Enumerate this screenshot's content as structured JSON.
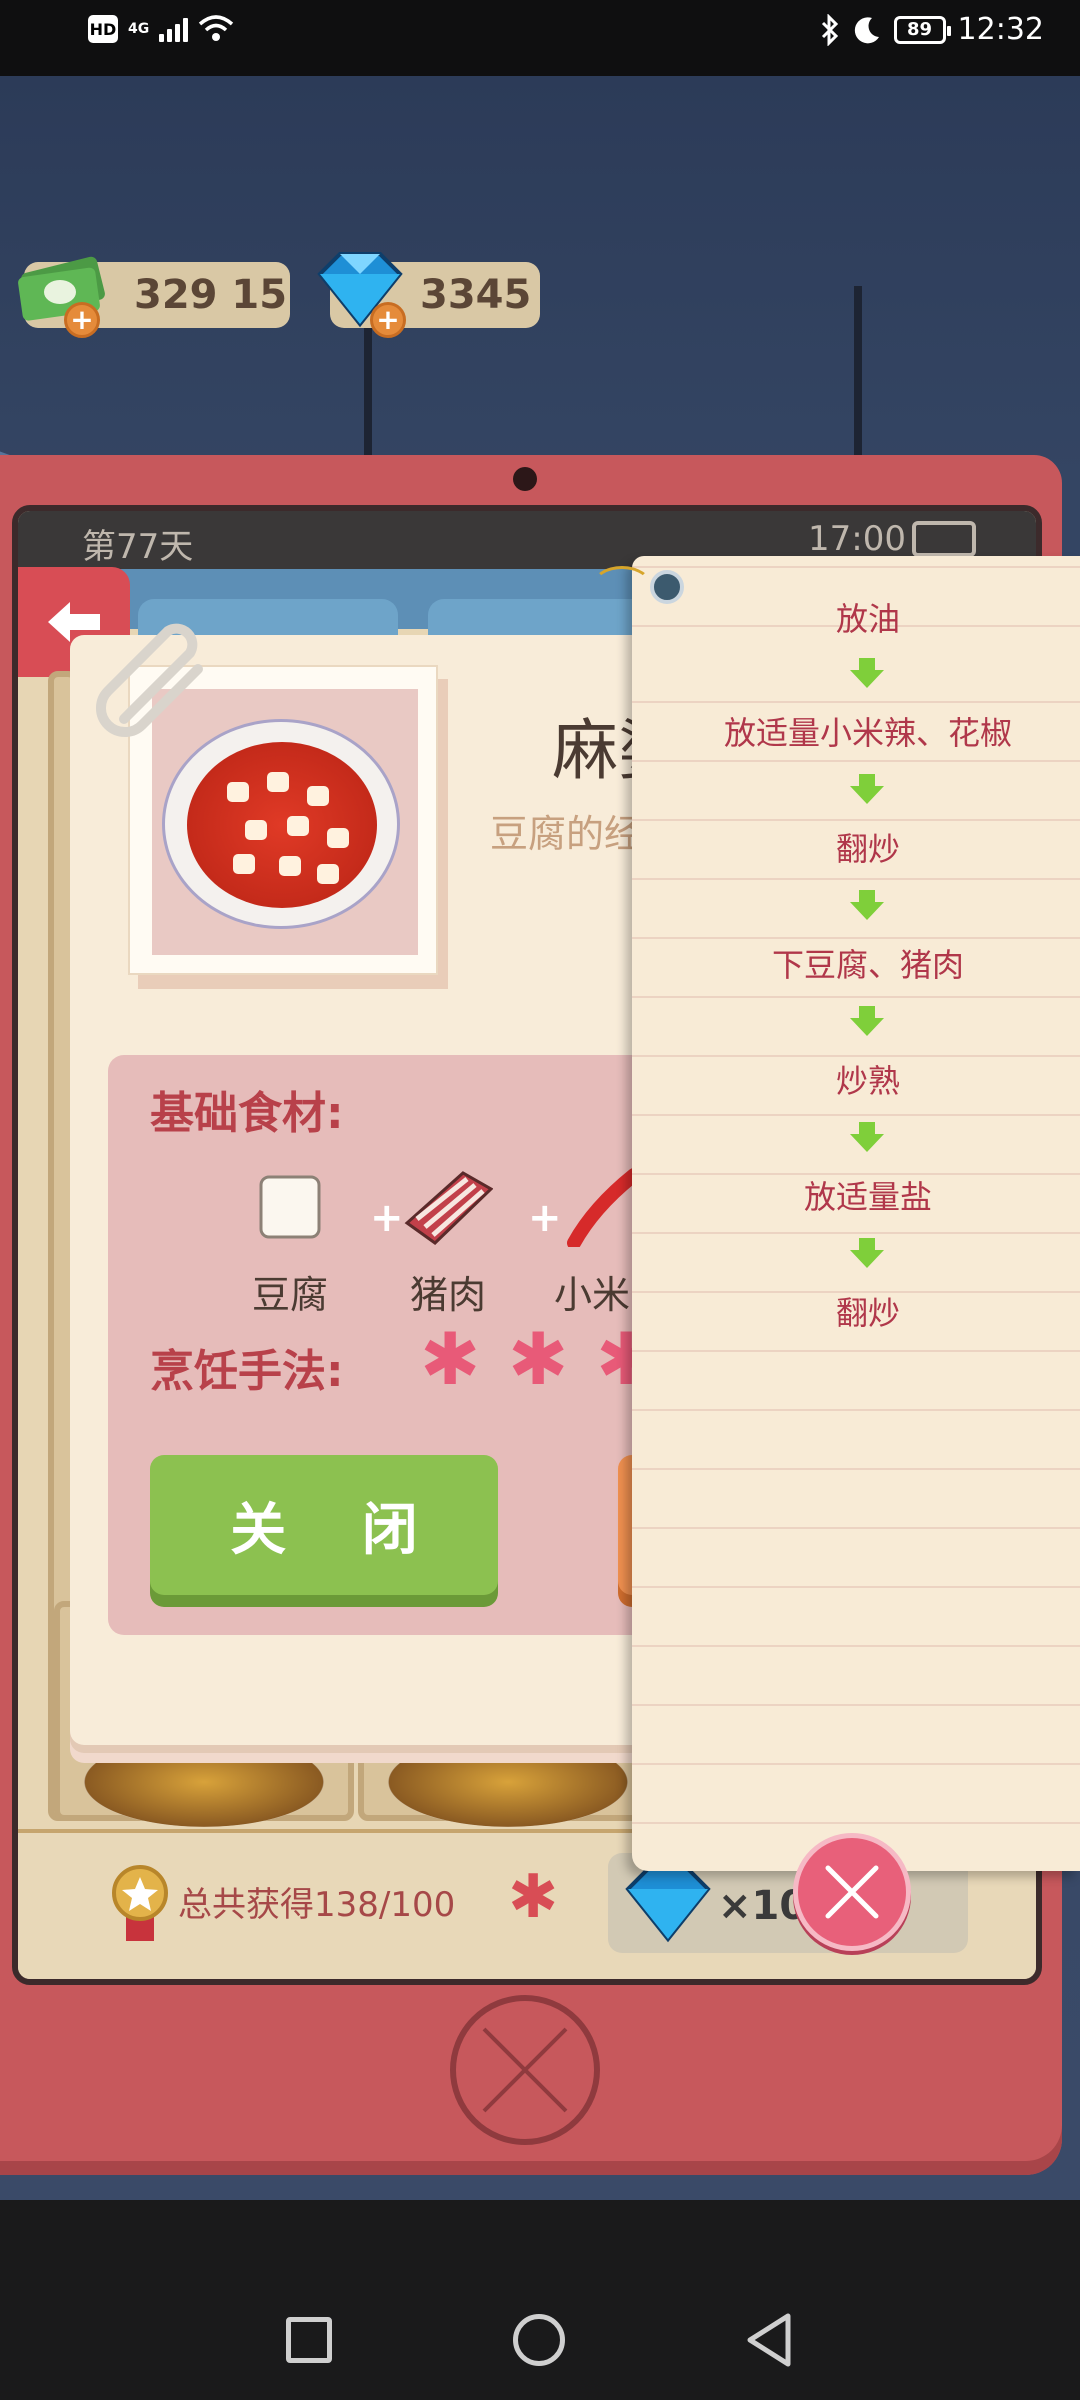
{
  "status_bar": {
    "hd": "HD",
    "network": "4G",
    "battery": "89",
    "time": "12:32"
  },
  "currency": {
    "cash": "329 15",
    "gems": "3345"
  },
  "device": {
    "day": "第77天",
    "clock": "17:00"
  },
  "recipe": {
    "name": "麻婆",
    "description": "豆腐的经",
    "base_ingredients_title": "基础食材:",
    "ingredients": [
      "豆腐",
      "猪肉",
      "小米"
    ],
    "technique_title": "烹饪手法:",
    "close_label": "关 闭"
  },
  "steps": [
    "放油",
    "放适量小米辣、花椒",
    "翻炒",
    "下豆腐、猪肉",
    "炒熟",
    "放适量盐",
    "翻炒"
  ],
  "footer": {
    "total": "总共获得138/100",
    "reward_qty": "×100"
  },
  "colors": {
    "accent_red": "#c7585c",
    "step_text": "#b0374a",
    "close_green": "#8cc150",
    "arrow_green": "#7fcf3a"
  }
}
